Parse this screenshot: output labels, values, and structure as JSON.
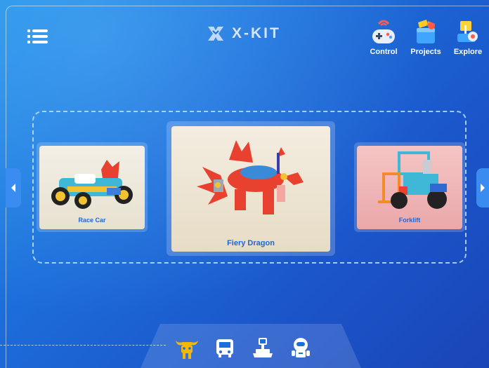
{
  "header": {
    "logo_text": "X-KIT",
    "actions": [
      {
        "label": "Control",
        "icon": "gamepad-icon"
      },
      {
        "label": "Projects",
        "icon": "projects-box-icon"
      },
      {
        "label": "Explore",
        "icon": "explore-flag-icon"
      }
    ]
  },
  "carousel": {
    "left_item": {
      "label": "Race Car"
    },
    "center_item": {
      "label": "Fiery Dragon"
    },
    "right_item": {
      "label": "Forklift"
    }
  },
  "bottom_nav": {
    "items": [
      {
        "icon": "bull-icon",
        "selected": true
      },
      {
        "icon": "bus-icon",
        "selected": false
      },
      {
        "icon": "tank-robot-icon",
        "selected": false
      },
      {
        "icon": "astronaut-robot-icon",
        "selected": false
      }
    ]
  },
  "colors": {
    "accent": "#1e66d6",
    "selected_icon": "#f5b800",
    "background": "#1c6fdb"
  }
}
